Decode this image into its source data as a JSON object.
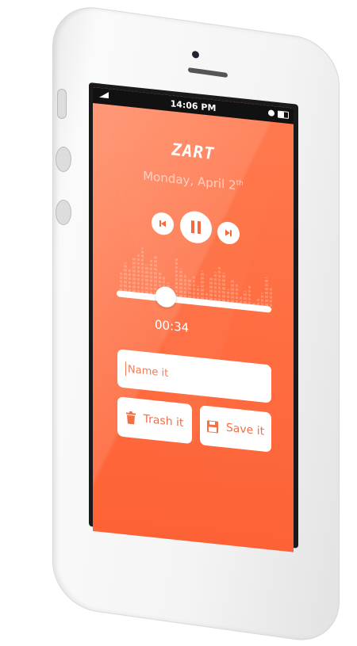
{
  "status_bar": {
    "time": "14:06 PM",
    "icons": [
      "signal-icon",
      "alarm-icon",
      "battery-icon"
    ]
  },
  "app": {
    "logo": "ZART",
    "date": "Monday, April 2",
    "date_suffix": "th",
    "accent": "#fd6236"
  },
  "player": {
    "elapsed": "00:34",
    "progress_percent": 32,
    "controls": [
      "previous-icon",
      "pause-icon",
      "next-icon"
    ],
    "equalizer_levels": [
      4,
      6,
      5,
      7,
      8,
      9,
      6,
      7,
      8,
      5,
      4,
      3,
      2,
      8,
      6,
      5,
      4,
      5,
      3,
      6,
      2,
      5,
      6,
      7,
      6,
      3,
      5,
      4,
      2,
      3,
      4,
      1,
      2,
      3,
      6,
      4
    ]
  },
  "form": {
    "name_placeholder": "Name it",
    "trash_label": "Trash it",
    "save_label": "Save it"
  }
}
